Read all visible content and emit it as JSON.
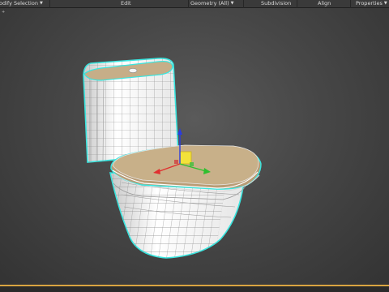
{
  "ribbon": {
    "items": [
      {
        "label": "odify Selection",
        "dropdown": true
      },
      {
        "label": "Edit",
        "dropdown": false
      },
      {
        "label": "Geometry (All)",
        "dropdown": true
      },
      {
        "label": "Subdivision",
        "dropdown": false
      },
      {
        "label": "Align",
        "dropdown": false
      },
      {
        "label": "Properties",
        "dropdown": true
      }
    ]
  },
  "viewport": {
    "label": "+",
    "object": "toilet-mesh",
    "selection_color": "#39e6e0",
    "gizmo_colors": {
      "x": "#e03030",
      "y": "#2fbf2f",
      "z": "#2a3be0",
      "plane": "#f2e23a"
    }
  }
}
